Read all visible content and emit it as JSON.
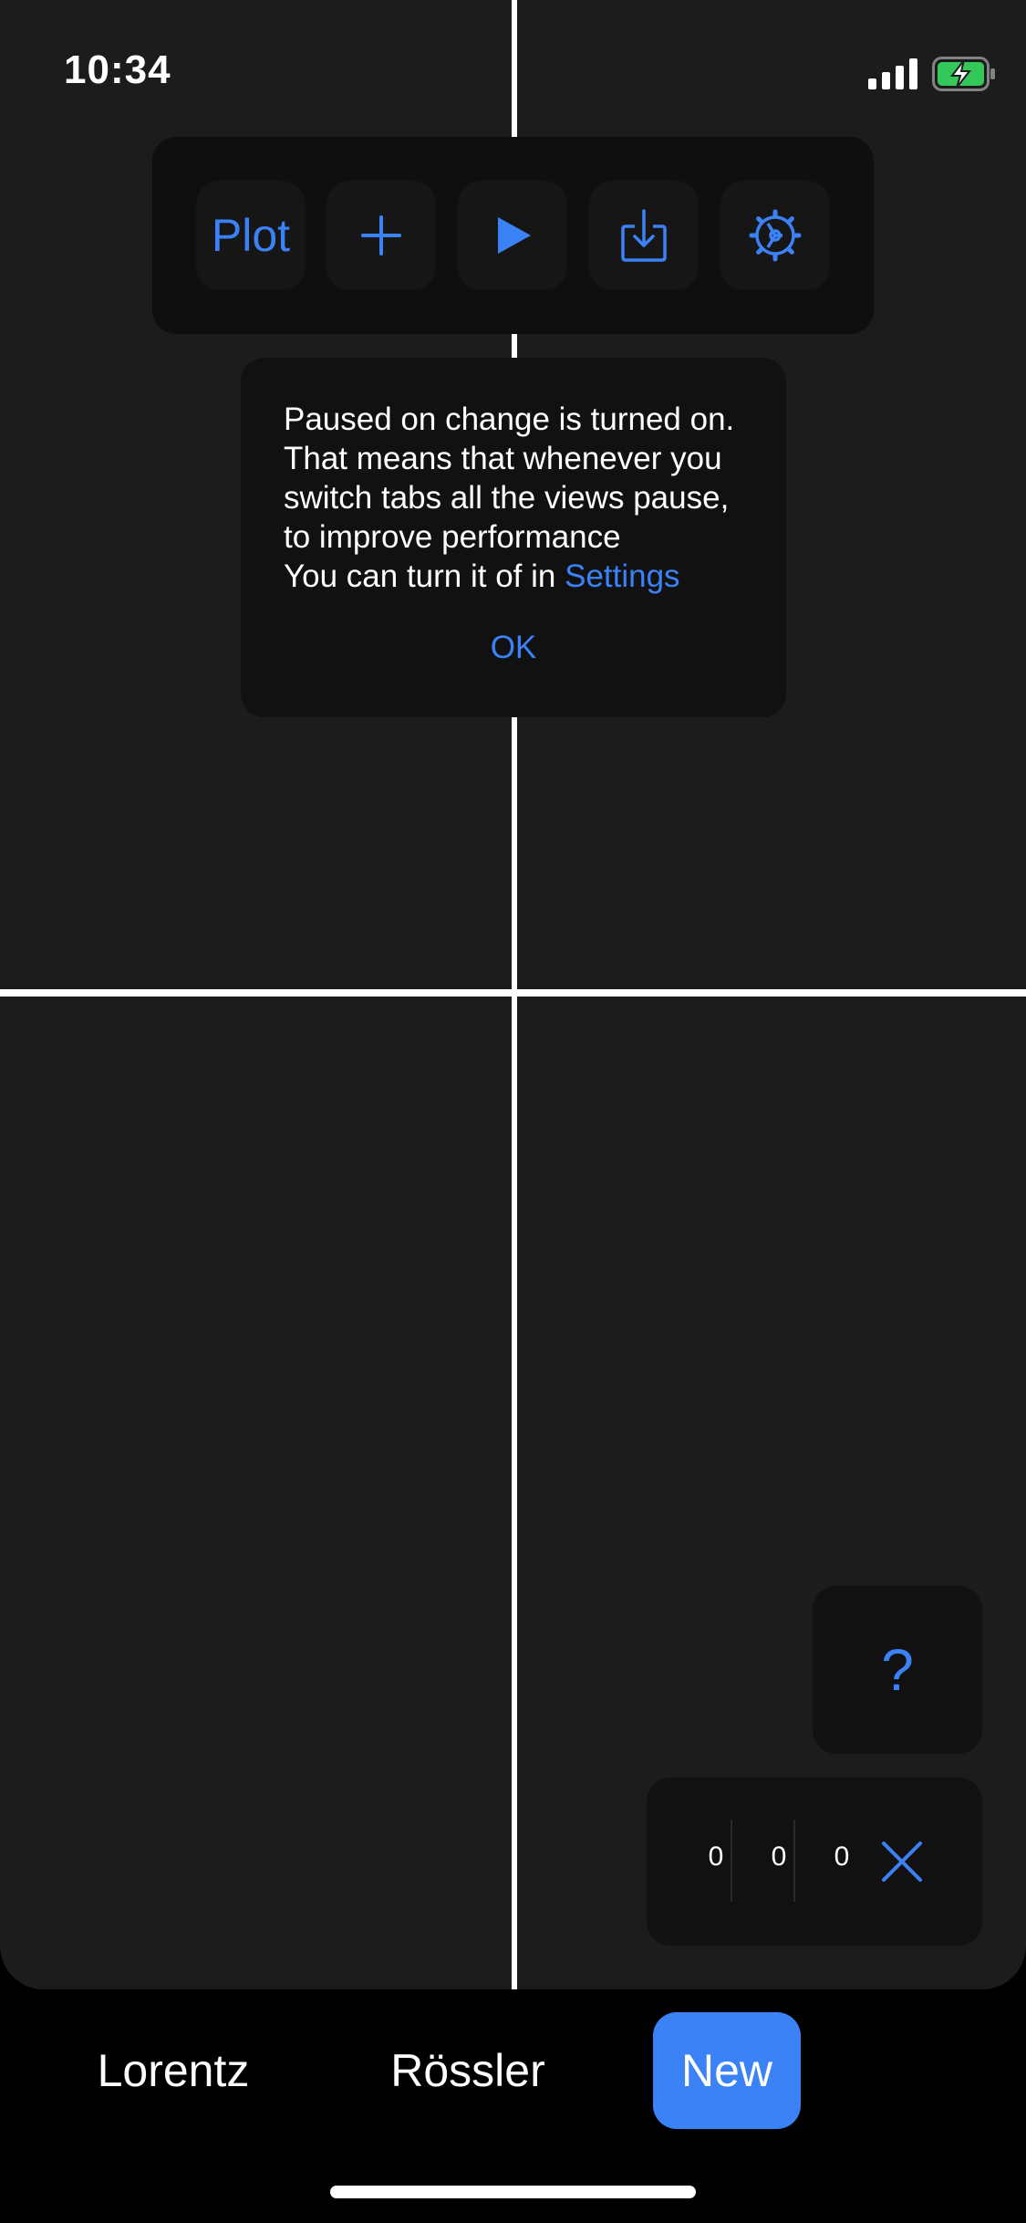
{
  "status_bar": {
    "time": "10:34",
    "signal_icon": "cellular-signal-icon",
    "battery_icon": "battery-charging-icon",
    "battery_color": "#34c759"
  },
  "toolbar": {
    "plot_label": "Plot",
    "add_icon": "plus-icon",
    "play_icon": "play-icon",
    "export_icon": "export-tray-icon",
    "settings_icon": "gear-icon"
  },
  "alert": {
    "message": "Paused on change is turned on. That means that whenever you switch tabs all the views pause, to improve performance\nYou can turn it of in ",
    "link_label": "Settings",
    "ok_label": "OK"
  },
  "help": {
    "label": "?"
  },
  "coordinates": {
    "x": "0",
    "y": "0",
    "z": "0",
    "close_icon": "close-icon"
  },
  "tabs": [
    {
      "label": "Lorentz",
      "selected": false
    },
    {
      "label": "Rössler",
      "selected": false
    },
    {
      "label": "New",
      "selected": true
    }
  ],
  "colors": {
    "accent": "#3b82f6",
    "canvas": "#1c1c1e",
    "panel": "#111111",
    "background": "#000000"
  }
}
